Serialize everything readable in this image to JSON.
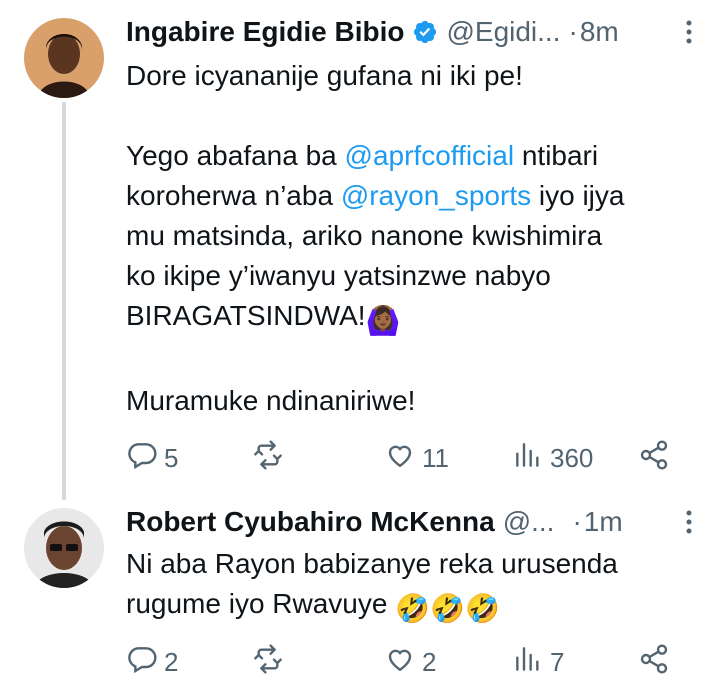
{
  "tweets": [
    {
      "name": "Ingabire Egidie Bibio",
      "handle": "@Egidi...",
      "dot": "·",
      "time": "8m",
      "verified": true,
      "text": {
        "line1": "Dore icyananije gufana ni iki pe!",
        "p2a": "Yego abafana ba ",
        "mention1": "@aprfcofficial",
        "p2b": " ntibari",
        "p2c": "koroherwa n’aba ",
        "mention2": "@rayon_sports",
        "p2d": " iyo ijya",
        "p2e": "mu matsinda, ariko nanone kwishimira",
        "p2f": "ko ikipe y’iwanyu yatsinzwe nabyo",
        "p2g": "BIRAGATSINDWA!",
        "emoji": "🙆🏾‍♀️",
        "line_last": "Muramuke ndinaniriwe!"
      },
      "actions": {
        "replies": "5",
        "retweets": "",
        "likes": "11",
        "views": "360"
      }
    },
    {
      "name": "Robert Cyubahiro McKenna",
      "handle": "@...",
      "dot": "·",
      "time": "1m",
      "verified": false,
      "text": {
        "line1": "Ni aba Rayon babizanye reka urusenda",
        "line2": "rugume iyo Rwavuye ",
        "emoji": "🤣🤣🤣"
      },
      "actions": {
        "replies": "2",
        "retweets": "",
        "likes": "2",
        "views": "7"
      }
    }
  ],
  "icons": {
    "reply": "reply-icon",
    "retweet": "retweet-icon",
    "like": "heart-icon",
    "views": "views-icon",
    "share": "share-icon",
    "more": "more-icon",
    "verified": "verified-badge-icon"
  },
  "colors": {
    "text": "#0f1419",
    "muted": "#536471",
    "link": "#1d9bf0",
    "thread": "#cfd9de"
  }
}
